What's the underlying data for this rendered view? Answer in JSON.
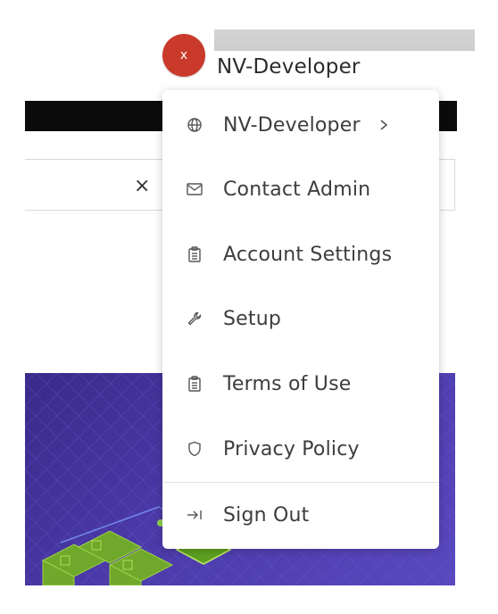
{
  "header": {
    "avatar_initial": "x",
    "org_name": "NV-Developer"
  },
  "search": {
    "clear_symbol": "×"
  },
  "menu": {
    "items": [
      {
        "label": "NV-Developer",
        "icon": "globe-icon",
        "has_submenu": true
      },
      {
        "label": "Contact Admin",
        "icon": "mail-icon"
      },
      {
        "label": "Account Settings",
        "icon": "clipboard-icon"
      },
      {
        "label": "Setup",
        "icon": "wrench-icon"
      },
      {
        "label": "Terms of Use",
        "icon": "clipboard-icon"
      },
      {
        "label": "Privacy Policy",
        "icon": "shield-icon"
      },
      {
        "label": "Sign Out",
        "icon": "sign-out-icon"
      }
    ]
  },
  "colors": {
    "avatar": "#c93a2b",
    "hero": "#4b3aa8",
    "accent_green": "#76b900"
  }
}
